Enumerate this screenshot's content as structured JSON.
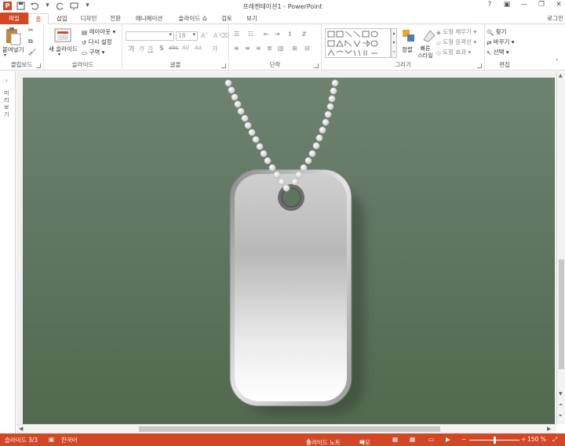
{
  "window": {
    "title": "프레젠테이션1 - PowerPoint",
    "logo": "P",
    "help": "?",
    "minimize": "—",
    "restore": "❐",
    "close": "✕"
  },
  "qat": {
    "save_icon": "floppy-disk",
    "undo_icon": "undo-arrow",
    "redo_icon": "redo-arrow"
  },
  "tabs": [
    {
      "label": "파일"
    },
    {
      "label": "홈"
    },
    {
      "label": "삽입"
    },
    {
      "label": "디자인"
    },
    {
      "label": "전환"
    },
    {
      "label": "애니메이션"
    },
    {
      "label": "슬라이드 쇼"
    },
    {
      "label": "검토"
    },
    {
      "label": "보기"
    }
  ],
  "login": "로그인",
  "ribbon": {
    "clipboard": {
      "label": "클립보드",
      "paste": "붙여넣기"
    },
    "slides": {
      "label": "슬라이드",
      "new_slide": "새 슬라이드",
      "layout": "레이아웃",
      "reset": "다시 설정",
      "section": "구역"
    },
    "font": {
      "label": "글꼴",
      "size": "18",
      "buttons": [
        "가",
        "가",
        "가",
        "가",
        "S",
        "abc",
        "AV",
        "Aa",
        "가"
      ]
    },
    "paragraph": {
      "label": "단락"
    },
    "drawing": {
      "label": "그리기",
      "arrange": "정렬",
      "quick_styles": "빠른 스타일",
      "shape_fill": "도형 채우기",
      "shape_outline": "도형 윤곽선",
      "shape_effects": "도형 효과"
    },
    "editing": {
      "label": "편집",
      "find": "찾기",
      "replace": "바꾸기",
      "select": "선택"
    }
  },
  "left_panel": {
    "collapse": "›",
    "label": "미리보기"
  },
  "status": {
    "slide": "슬라이드 3/3",
    "language": "한국어",
    "notes": "슬라이드 노트",
    "comments": "메모",
    "zoom_out": "−",
    "zoom_in": "+",
    "zoom": "150 %",
    "zoom_fraction": 0.5
  },
  "colors": {
    "accent": "#d24726",
    "slide_bg": "#5d745e"
  }
}
